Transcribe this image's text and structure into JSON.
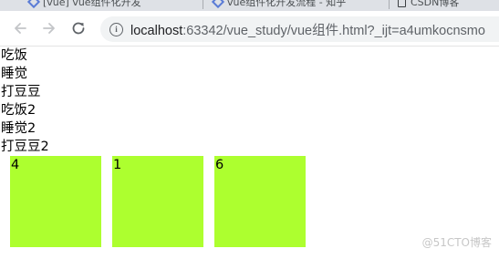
{
  "browser": {
    "tabs": [
      {
        "label": "[vue] vue组件化开发",
        "favicon": "vue-icon"
      },
      {
        "label": "vue组件化开发流程 - 知乎",
        "favicon": "vue-icon"
      },
      {
        "label": "CSDN博客",
        "favicon": "doc-icon"
      }
    ],
    "url_host": "localhost",
    "url_rest": ":63342/vue_study/vue组件.html?_ijt=a4umkocnsmo"
  },
  "page": {
    "list": [
      "吃饭",
      "睡觉",
      "打豆豆",
      "吃饭2",
      "睡觉2",
      "打豆豆2"
    ],
    "boxes": [
      "4",
      "1",
      "6"
    ],
    "box_color": "#adff2f"
  },
  "watermark": "@51CTO博客"
}
